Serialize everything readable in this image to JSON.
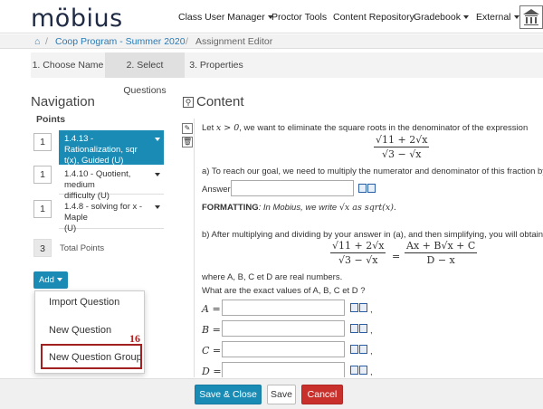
{
  "header": {
    "logo": "möbius",
    "nav": [
      {
        "label": "Class User Manager",
        "dropdown": true
      },
      {
        "label": "Proctor Tools",
        "dropdown": false
      },
      {
        "label": "Content Repository",
        "dropdown": false
      },
      {
        "label": "Gradebook",
        "dropdown": true
      },
      {
        "label": "External",
        "dropdown": true
      }
    ]
  },
  "breadcrumb": {
    "home_icon": "home-icon",
    "course": "Coop Program - Summer 2020",
    "current": "Assignment Editor"
  },
  "steps": [
    {
      "label": "1. Choose Name"
    },
    {
      "label": "2. Select Questions",
      "active": true
    },
    {
      "label": "3. Properties"
    }
  ],
  "navigation": {
    "title": "Navigation",
    "points_label": "Points",
    "questions": [
      {
        "points": "1",
        "label": "1.4.13 - Rationalization, sqr... t(x), Guided (U)",
        "line1": "1.4.13 - Rationalization, sqr",
        "line2": "t(x), Guided (U)",
        "active": true
      },
      {
        "points": "1",
        "label": "1.4.10 - Quotient, medium difficulty (U)",
        "line1": "1.4.10 - Quotient, medium",
        "line2": "difficulty (U)",
        "active": false
      },
      {
        "points": "1",
        "label": "1.4.8 - solving for x - Maple (U)",
        "line1": "1.4.8 - solving for x - Maple",
        "line2": "(U)",
        "active": false
      }
    ],
    "total_points": "3",
    "total_label": "Total Points",
    "add_button": "Add",
    "add_menu": [
      "Import Question",
      "New Question",
      "New Question Group"
    ],
    "annotation": "16"
  },
  "content": {
    "title": "Content",
    "intro_pre": "Let",
    "intro_math": "x > 0",
    "intro_post": ", we want to eliminate the square roots in the denominator of the expression",
    "expr_num": "√11 + 2√x",
    "expr_den": "√3 − √x",
    "part_a": "a) To reach our goal, we need to multiply the numerator and denominator of this fraction by what factor?",
    "answer_label": "Answer:",
    "formatting_label": "FORMATTING",
    "formatting_text": ": In Mobius, we write",
    "formatting_math": "√x  as sqrt(x).",
    "part_b": "b) After multiplying and dividing by your answer in (a), and then simplifying, you will obtain a new expressi",
    "eq_lhs_num": "√11 + 2√x",
    "eq_lhs_den": "√3 − √x",
    "eq_sign": "=",
    "eq_rhs_num": "Ax + B√x + C",
    "eq_rhs_den": "D − x",
    "where_text": "where A, B, C et D are real numbers.",
    "question_text": "What are the exact values of A, B, C et D ?",
    "fields": [
      "A =",
      "B =",
      "C =",
      "D ="
    ],
    "field_suffix": ","
  },
  "footer": {
    "save_close": "Save & Close",
    "save": "Save",
    "cancel": "Cancel"
  }
}
